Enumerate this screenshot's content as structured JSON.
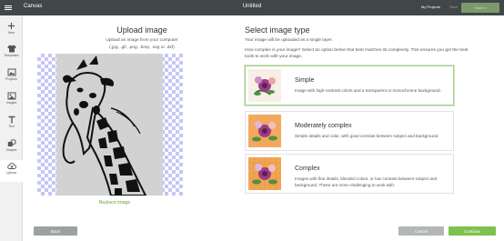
{
  "header": {
    "app_title": "Canvas",
    "doc_title": "Untitled",
    "my_projects": "My Projects",
    "save": "Save",
    "make_it": "Make It"
  },
  "sidebar": {
    "items": [
      {
        "label": "New",
        "icon": "plus-icon"
      },
      {
        "label": "Templates",
        "icon": "tshirt-icon"
      },
      {
        "label": "Projects",
        "icon": "projects-icon"
      },
      {
        "label": "Images",
        "icon": "image-icon"
      },
      {
        "label": "Text",
        "icon": "text-icon"
      },
      {
        "label": "Shapes",
        "icon": "shapes-icon"
      },
      {
        "label": "Upload",
        "icon": "upload-icon"
      }
    ]
  },
  "upload": {
    "title": "Upload image",
    "description": "Upload an image from your computer",
    "formats": "(.jpg, .gif, .png, .bmp, .svg or .dxf)",
    "replace": "Replace image"
  },
  "select": {
    "title": "Select image type",
    "subtitle": "Your image will be uploaded as a single layer.",
    "help": "How complex is your image? Select an option below that best matches its complexity. This ensures you get the best tools to work with your image.",
    "options": [
      {
        "name": "Simple",
        "description": "Image with high-contrast colors and a transparent or monochrome background.",
        "selected": true
      },
      {
        "name": "Moderately complex",
        "description": "Simple details and color, with good contrast between subject and background.",
        "selected": false
      },
      {
        "name": "Complex",
        "description": "Images with fine details, blended colors, or low contrast between subject and background. These are more challenging to work with.",
        "selected": false
      }
    ]
  },
  "footer": {
    "back": "Back",
    "cancel": "Cancel",
    "continue": "Continue"
  },
  "colors": {
    "topbar": "#414748",
    "accent_green": "#7ec14e",
    "link_green": "#6aa23f",
    "checker": "#c5c6f5"
  }
}
